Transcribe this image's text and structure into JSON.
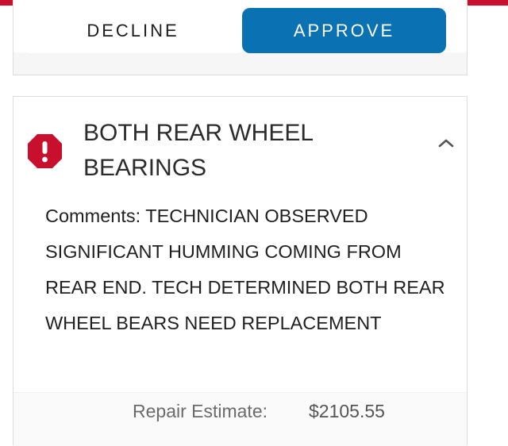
{
  "actions": {
    "decline_label": "DECLINE",
    "approve_label": "APPROVE"
  },
  "service": {
    "title_line1": "BOTH REAR WHEEL",
    "title_line2": "BEARINGS",
    "status_icon": "alert-octagon-icon",
    "comments": "Comments: TECHNICIAN OBSERVED SIGNIFICANT HUMMING COMING FROM REAR END. TECH DETERMINED BOTH REAR WHEEL BEARS NEED REPLACEMENT",
    "estimate_label": "Repair Estimate:",
    "estimate_value": "$2105.55"
  },
  "colors": {
    "brand_red": "#c8102e",
    "approve_blue": "#0a72b3",
    "alert_red": "#c8102e"
  }
}
